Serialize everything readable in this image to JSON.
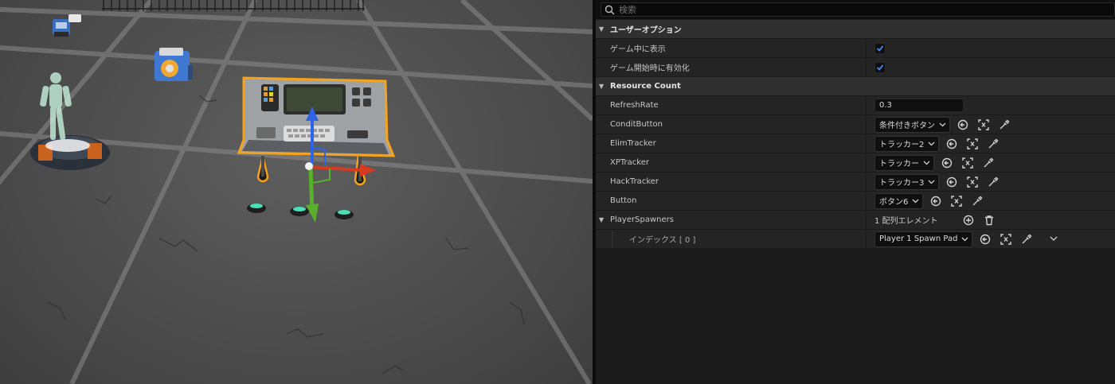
{
  "search": {
    "placeholder": "検索"
  },
  "sections": {
    "user_options": {
      "title": "ユーザーオプション",
      "props": {
        "visible_in_game": {
          "label": "ゲーム中に表示",
          "checked": true
        },
        "enabled_at_start": {
          "label": "ゲーム開始時に有効化",
          "checked": true
        }
      }
    },
    "resource_count": {
      "title": "Resource Count",
      "props": {
        "refresh_rate": {
          "label": "RefreshRate",
          "value": "0.3"
        },
        "condit_button": {
          "label": "ConditButton",
          "value": "条件付きボタン"
        },
        "elim_tracker": {
          "label": "ElimTracker",
          "value": "トラッカー2"
        },
        "xp_tracker": {
          "label": "XPTracker",
          "value": "トラッカー"
        },
        "hack_tracker": {
          "label": "HackTracker",
          "value": "トラッカー3"
        },
        "button": {
          "label": "Button",
          "value": "ボタン6"
        },
        "player_spawners": {
          "label": "PlayerSpawners",
          "count_text": "1 配列エレメント",
          "index0": {
            "label": "インデックス [ 0 ]",
            "value": "Player 1 Spawn Pad"
          }
        }
      }
    }
  },
  "icons": {
    "search": "search-icon",
    "reset": "browse-arrow-icon",
    "select": "select-actor-icon",
    "pick": "eyedropper-icon",
    "add": "plus-circle-icon",
    "delete": "trash-icon",
    "check": "checkmark-icon"
  },
  "colors": {
    "accent_blue": "#1a6bd8",
    "selection_orange": "#f7a21b",
    "panel_bg": "#1a1a1a",
    "category_bg": "#303030",
    "row_bg": "#242424"
  }
}
